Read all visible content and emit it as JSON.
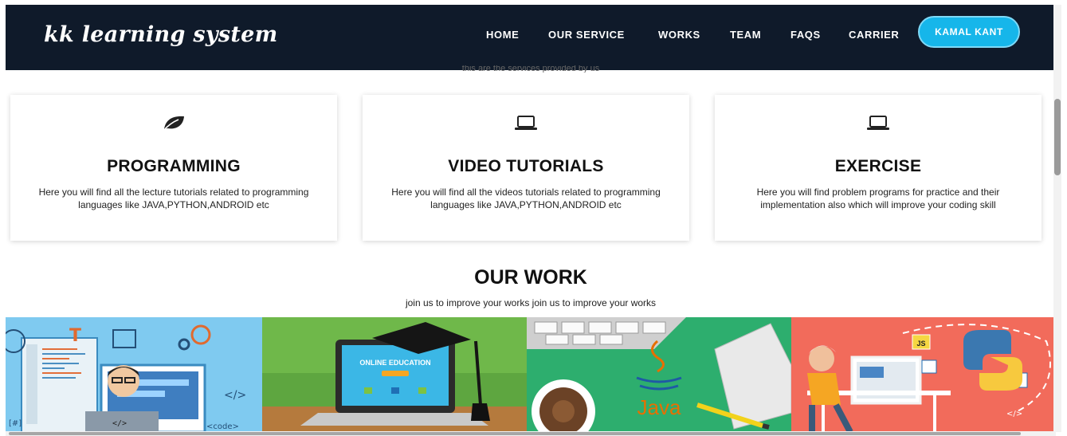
{
  "brand": "kk learning system",
  "nav": {
    "items": [
      "HOME",
      "OUR SERVICE",
      "WORKS",
      "TEAM",
      "FAQS",
      "CARRIER"
    ],
    "user_button": "KAMAL KANT"
  },
  "services_caption": "this are the services provided by us",
  "services": [
    {
      "icon": "leaf-icon",
      "title": "PROGRAMMING",
      "text": "Here you will find all the lecture tutorials related to programming languages like JAVA,PYTHON,ANDROID etc"
    },
    {
      "icon": "laptop-icon",
      "title": "VIDEO TUTORIALS",
      "text": "Here you will find all the videos tutorials related to programming languages like JAVA,PYTHON,ANDROID etc"
    },
    {
      "icon": "laptop-icon",
      "title": "EXERCISE",
      "text": "Here you will find problem programs for practice and their implementation also which will improve your coding skill"
    }
  ],
  "work": {
    "title": "OUR WORK",
    "subtitle": "join us to improve your works join us to improve your works"
  },
  "gallery": {
    "tile1": {
      "text": "<code>"
    },
    "tile2": {
      "banner": "ONLINE EDUCATION"
    },
    "tile3": {
      "text": "Java"
    },
    "tile4": {
      "text": "JS"
    }
  },
  "colors": {
    "navbar": "#0f1a2a",
    "accent": "#16b6ea"
  }
}
